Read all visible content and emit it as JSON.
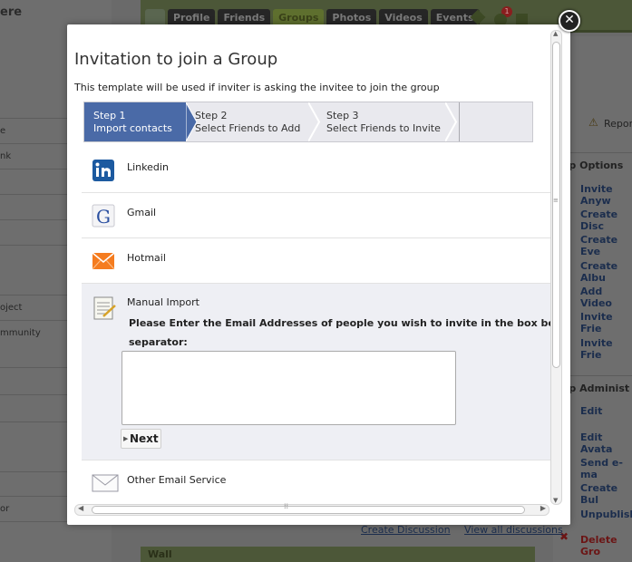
{
  "background": {
    "left_title": "ere",
    "left_rows": [
      "e",
      "nk",
      "",
      "",
      "",
      "oject",
      "mmunity",
      "",
      "",
      "",
      "",
      "",
      "or",
      ""
    ],
    "tabs": [
      "Profile",
      "Friends",
      "Groups",
      "Photos",
      "Videos",
      "Events"
    ],
    "notification_count": "1",
    "report_label": "Report",
    "group_options_heading": "oup Options",
    "group_options": [
      "Invite Anyw",
      "Create Disc",
      "Create Eve",
      "Create Albu",
      "Add Video",
      "Invite Frie",
      "Invite Frie"
    ],
    "group_admin_heading": "oup Administ",
    "group_admin": [
      "Edit",
      "Edit Avata",
      "Send e-ma",
      "Create Bul",
      "Unpublish",
      "Delete Gro"
    ],
    "create_discussion": "Create Discussion",
    "view_all_discussions": "View all discussions",
    "wall_label": "Wall"
  },
  "modal": {
    "title": "Invitation to join a Group",
    "description": "This template will be used if inviter is asking the invitee to join the group",
    "steps": [
      {
        "num": "Step 1",
        "label": "Import contacts"
      },
      {
        "num": "Step 2",
        "label": "Select Friends to Add"
      },
      {
        "num": "Step 3",
        "label": "Select Friends to Invite"
      }
    ],
    "providers": {
      "linkedin": "Linkedin",
      "gmail": "Gmail",
      "hotmail": "Hotmail"
    },
    "manual": {
      "label": "Manual Import",
      "instruction_line1": "Please Enter the Email Addresses of people you wish to invite in the box below. Use Co",
      "instruction_line2": "separator:",
      "textarea_value": "",
      "next_label": "Next"
    },
    "other_label": "Other Email Service",
    "close_symbol": "✕"
  },
  "colors": {
    "step_active": "#4a6aa7",
    "manual_bg": "#eeeff4"
  }
}
